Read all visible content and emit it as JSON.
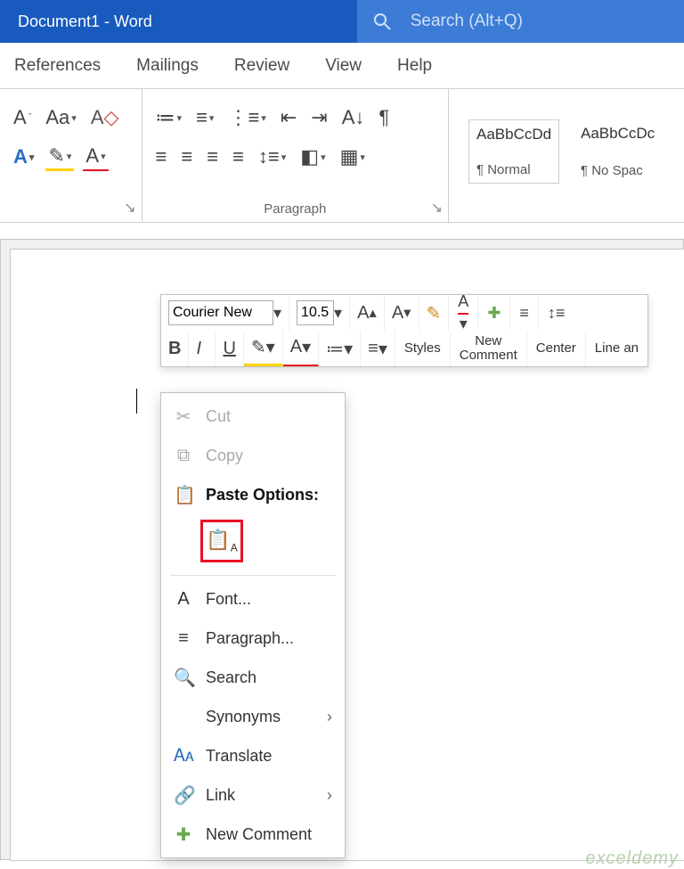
{
  "titlebar": {
    "title": "Document1 - Word",
    "search_placeholder": "Search (Alt+Q)"
  },
  "tabs": {
    "references": "References",
    "mailings": "Mailings",
    "review": "Review",
    "view": "View",
    "help": "Help"
  },
  "ribbon": {
    "paragraph_label": "Paragraph",
    "styles": {
      "preview": "AaBbCcDd",
      "normal": "¶ Normal",
      "nospace_preview": "AaBbCcDc",
      "nospace": "¶ No Spac"
    }
  },
  "minitoolbar": {
    "font": "Courier New",
    "size": "10.5",
    "styles": "Styles",
    "comment1": "New",
    "comment2": "Comment",
    "center": "Center",
    "line": "Line an"
  },
  "context": {
    "cut": "Cut",
    "copy": "Copy",
    "paste_header": "Paste Options:",
    "font": "Font...",
    "paragraph": "Paragraph...",
    "search": "Search",
    "synonyms": "Synonyms",
    "translate": "Translate",
    "link": "Link",
    "new_comment": "New Comment"
  },
  "watermark": "exceldemy"
}
